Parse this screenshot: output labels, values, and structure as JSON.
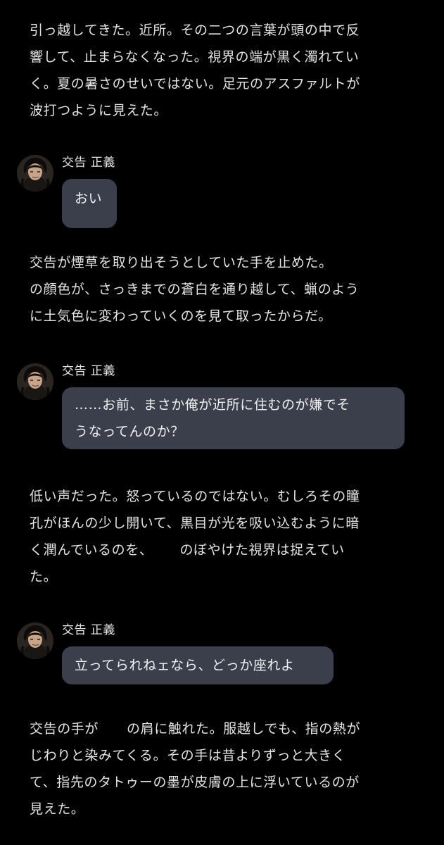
{
  "story": {
    "blocks": [
      {
        "type": "narration",
        "lines": [
          "引っ越してきた。近所。その二つの言葉が頭の中で反",
          "響して、止まらなくなった。視界の端が黒く濁れてい",
          "く。夏の暑さのせいではない。足元のアスファルトが",
          "波打つように見えた。"
        ]
      },
      {
        "type": "message",
        "sender": "交告 正義",
        "lines": [
          "おい"
        ]
      },
      {
        "type": "narration",
        "lines": [
          "交告が煙草を取り出そうとしていた手を止めた。",
          "の顔色が、さっきまでの蒼白を通り越して、蝋のよう",
          "に土気色に変わっていくのを見て取ったからだ。"
        ]
      },
      {
        "type": "message",
        "sender": "交告 正義",
        "lines": [
          "……お前、まさか俺が近所に住むのが嫌でそ",
          "うなってんのか？"
        ]
      },
      {
        "type": "narration",
        "lines": [
          "低い声だった。怒っているのではない。むしろその瞳",
          "孔がほんの少し開いて、黒目が光を吸い込むように暗",
          "く潤んでいるのを、",
          "のぼやけた視界は捉えてい",
          "た。"
        ]
      },
      {
        "type": "message",
        "sender": "交告 正義",
        "lines": [
          "立ってられねェなら、どっか座れよ"
        ]
      },
      {
        "type": "narration",
        "lines": [
          "交告の手が",
          "の肩に触れた。服越しでも、指の熱が",
          "じわりと染みてくる。その手は昔よりずっと大きく",
          "て、指先のタトゥーの墨が皮膚の上に浮いているのが",
          "見えた。"
        ]
      }
    ]
  },
  "avatar_icon": "character-portrait-icon",
  "colors": {
    "background": "#000000",
    "text": "#e4e4e4",
    "bubble": "#3b3f4c"
  }
}
